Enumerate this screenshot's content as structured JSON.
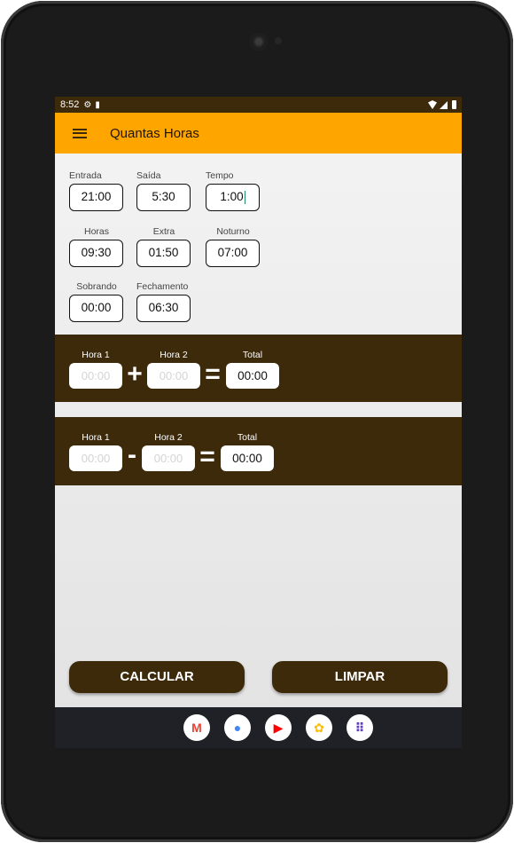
{
  "status_bar": {
    "time": "8:52"
  },
  "app_bar": {
    "title": "Quantas Horas"
  },
  "fields": {
    "entrada": {
      "label": "Entrada",
      "value": "21:00"
    },
    "saida": {
      "label": "Saída",
      "value": "5:30"
    },
    "tempo": {
      "label": "Tempo",
      "value": "1:00"
    },
    "horas": {
      "label": "Horas",
      "value": "09:30"
    },
    "extra": {
      "label": "Extra",
      "value": "01:50"
    },
    "noturno": {
      "label": "Noturno",
      "value": "07:00"
    },
    "sobrando": {
      "label": "Sobrando",
      "value": "00:00"
    },
    "fechamento": {
      "label": "Fechamento",
      "value": "06:30"
    }
  },
  "add_calc": {
    "hora1_label": "Hora 1",
    "hora1_placeholder": "00:00",
    "hora2_label": "Hora 2",
    "hora2_placeholder": "00:00",
    "operator": "+",
    "equals": "=",
    "total_label": "Total",
    "total_value": "00:00"
  },
  "sub_calc": {
    "hora1_label": "Hora 1",
    "hora1_placeholder": "00:00",
    "hora2_label": "Hora 2",
    "hora2_placeholder": "00:00",
    "operator": "-",
    "equals": "=",
    "total_label": "Total",
    "total_value": "00:00"
  },
  "buttons": {
    "calcular": "CALCULAR",
    "limpar": "LIMPAR"
  },
  "dock": [
    {
      "name": "gmail-icon",
      "glyph": "M",
      "color": "#ea4335"
    },
    {
      "name": "chrome-icon",
      "glyph": "●",
      "color": "#4285f4"
    },
    {
      "name": "youtube-icon",
      "glyph": "▶",
      "color": "#ff0000"
    },
    {
      "name": "photos-icon",
      "glyph": "✿",
      "color": "#fbbc04"
    },
    {
      "name": "app-drawer-icon",
      "glyph": "⠿",
      "color": "#5f3dc4"
    }
  ],
  "colors": {
    "accent": "#ffa500",
    "panel": "#3d2a0a"
  }
}
